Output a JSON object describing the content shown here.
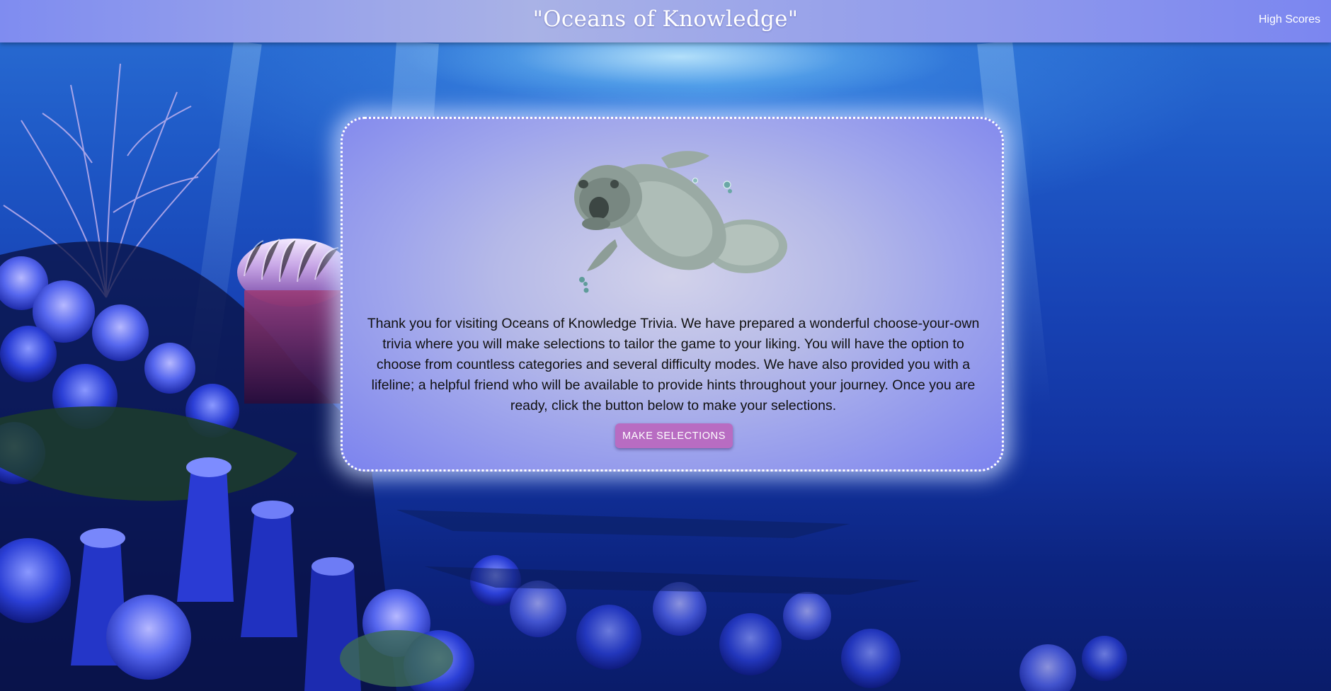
{
  "header": {
    "title": "\"Oceans of Knowledge\"",
    "high_scores_link": "High Scores"
  },
  "intro": {
    "mascot_icon": "manatee-illustration",
    "message": "Thank you for visiting Oceans of Knowledge Trivia. We have prepared a wonderful choose-your-own trivia where you will make selections to tailor the game to your liking. You will have the option to choose from countless categories and several difficulty modes. We have also provided you with a lifeline; a helpful friend who will be available to provide hints throughout your journey. Once you are ready, click the button below to make your selections.",
    "button_label": "MAKE SELECTIONS"
  },
  "background": {
    "scene": "underwater-coral-reef"
  },
  "colors": {
    "header_gradient_start": "#7f8cf0",
    "header_gradient_mid": "#a9b2e6",
    "card_center": "#d2d2ea",
    "card_edge": "#7c83ee",
    "button": "#b86cc2",
    "ocean_deep": "#0a1c6a",
    "ocean_light": "#2a6fd4"
  }
}
